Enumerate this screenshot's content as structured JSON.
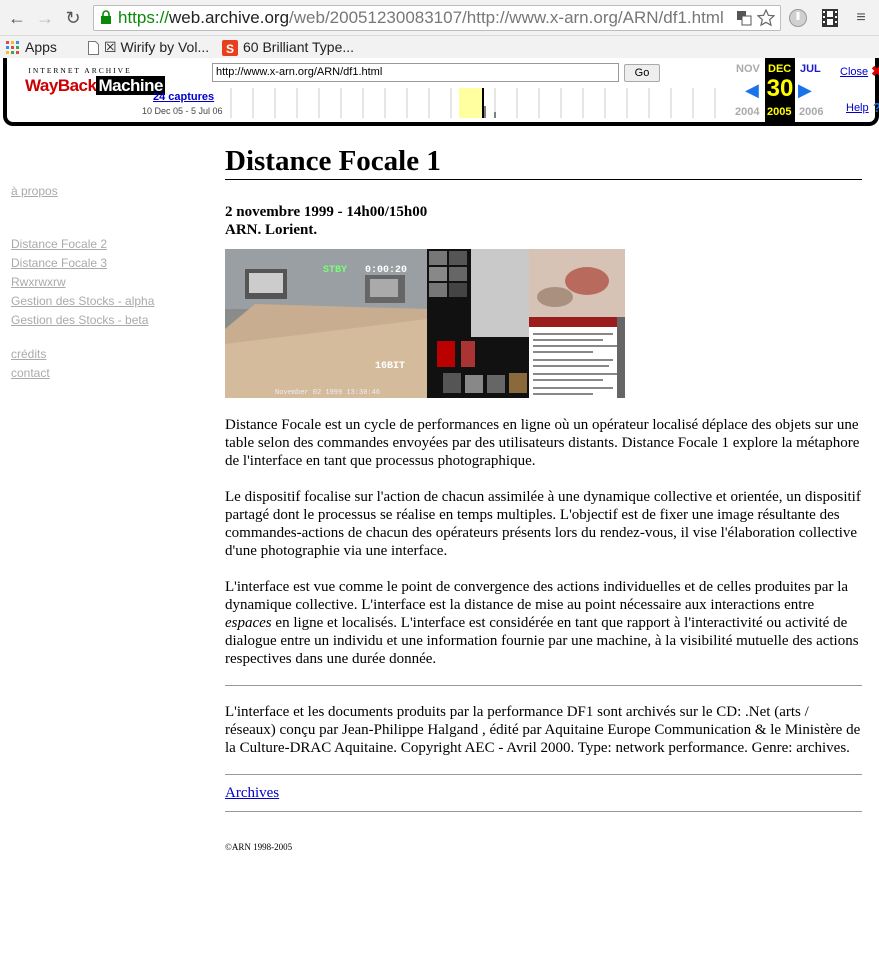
{
  "browser": {
    "url_scheme": "https://",
    "url_host": "web.archive.org",
    "url_rest": "/web/20051230083107/http://www.x-arn.org/ARN/df1.html"
  },
  "bookmarks": {
    "items": [
      {
        "label": "Apps",
        "icon": "apps-grid-icon"
      },
      {
        "label": "☒ Wirify by Vol...",
        "icon": "page-icon"
      },
      {
        "label": "60 Brilliant Type...",
        "icon": "site-favicon-icon"
      }
    ]
  },
  "wayback": {
    "logo_top": "INTERNET ARCHIVE",
    "logo_main_1": "WayBack",
    "logo_main_2": "Machine",
    "url_value": "http://www.x-arn.org/ARN/df1.html",
    "go_label": "Go",
    "captures_label": "24 captures",
    "range_label": "10 Dec 05 - 5 Jul 06",
    "prev_month": "NOV",
    "cur_month": "DEC",
    "next_month": "JUL",
    "day": "30",
    "prev_year": "2004",
    "cur_year": "2005",
    "next_year": "2006",
    "close_label": "Close",
    "help_label": "Help"
  },
  "sidebar": {
    "items": [
      {
        "label": "à propos"
      },
      {
        "label": "Distance Focale 2"
      },
      {
        "label": "Distance Focale 3"
      },
      {
        "label": "Rwxrwxrw"
      },
      {
        "label": "Gestion des Stocks - alpha"
      },
      {
        "label": "Gestion des Stocks - beta"
      },
      {
        "label": "crédits"
      },
      {
        "label": "contact"
      }
    ]
  },
  "main": {
    "title": "Distance Focale 1",
    "date_line": "2 novembre 1999 - 14h00/15h00",
    "place_line": "ARN. Lorient.",
    "photo_overlay": {
      "stby": "STBY",
      "timecode": "0:00:20",
      "bit": "16BIT",
      "date_stamp": "November 02 1999 13:30:46"
    },
    "paragraph_1": "Distance Focale est un cycle de performances en ligne où un opérateur localisé déplace des objets sur une table selon des commandes envoyées par des utilisateurs distants. Distance Focale 1 explore la métaphore de l'interface en tant que processus photographique.",
    "paragraph_2": "Le dispositif focalise sur l'action de chacun assimilée à une dynamique collective et orientée, un dispositif partagé dont le processus se réalise en temps multiples. L'objectif est de fixer une image résultante des commandes-actions de chacun des opérateurs présents lors du rendez-vous, il vise l'élaboration collective d'une photographie via une interface.",
    "paragraph_3a": "L'interface est vue comme le point de convergence des actions individuelles et de celles produites par la dynamique collective. L'interface est la distance de mise au point nécessaire aux interactions entre ",
    "paragraph_3_em": "espaces",
    "paragraph_3b": " en ligne et localisés. L'interface est considérée en tant que rapport à l'interactivité ou activité de dialogue entre un individu et une information fournie par une machine, à la visibilité mutuelle des actions respectives dans une durée donnée.",
    "paragraph_4": "L'interface et les documents produits par la performance DF1 sont archivés sur le CD: .Net (arts / réseaux) conçu par Jean-Philippe Halgand , édité par Aquitaine Europe Communication & le Ministère de la Culture-DRAC Aquitaine. Copyright AEC - Avril 2000. Type: network performance. Genre: archives.",
    "archives_label": "Archives",
    "copyright": "©ARN 1998-2005"
  }
}
